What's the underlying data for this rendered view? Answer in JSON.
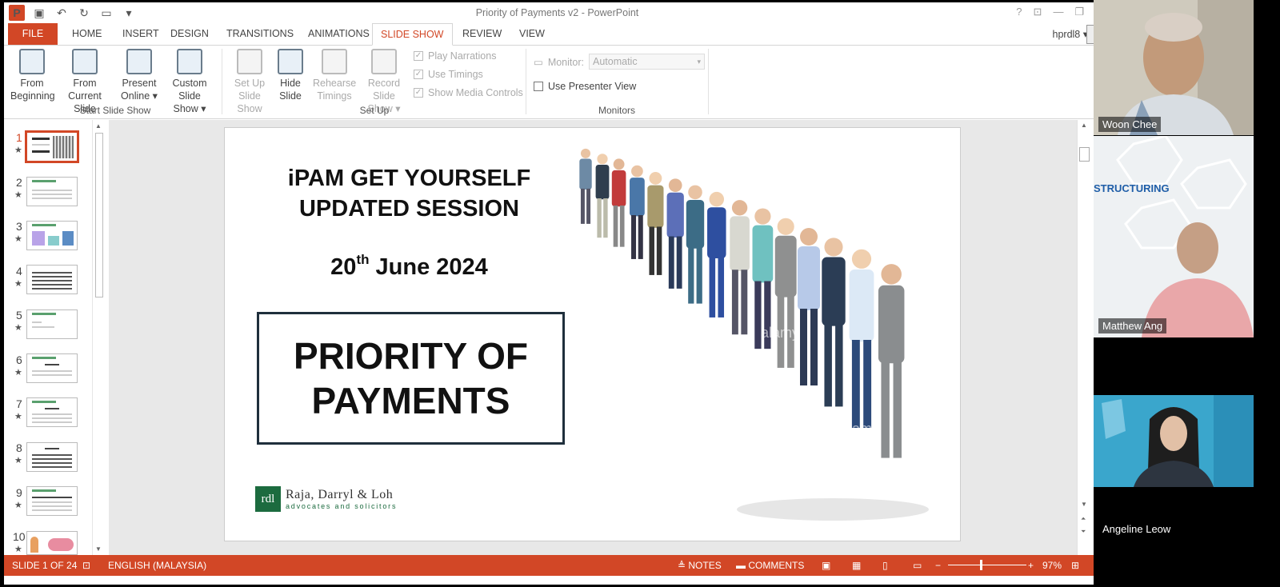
{
  "window": {
    "title": "Priority of Payments v2 - PowerPoint",
    "controls": [
      "?",
      "⊡",
      "—",
      "❐",
      "✕"
    ]
  },
  "qat": {
    "icons": [
      "powerpoint-icon",
      "save-icon",
      "undo-icon",
      "redo-icon",
      "present-icon",
      "customize-icon"
    ]
  },
  "tabs": [
    "FILE",
    "HOME",
    "INSERT",
    "DESIGN",
    "TRANSITIONS",
    "ANIMATIONS",
    "SLIDE SHOW",
    "REVIEW",
    "VIEW"
  ],
  "active_tab": "SLIDE SHOW",
  "user": {
    "name": "hprdl8"
  },
  "ribbon": {
    "start": {
      "from_beginning": [
        "From",
        "Beginning"
      ],
      "from_current": [
        "From",
        "Current Slide"
      ],
      "present_online": [
        "Present",
        "Online ▾"
      ],
      "custom_show": [
        "Custom Slide",
        "Show ▾"
      ],
      "label": "Start Slide Show"
    },
    "setup": {
      "setup_show": [
        "Set Up",
        "Slide Show"
      ],
      "hide_slide": [
        "Hide",
        "Slide"
      ],
      "rehearse": [
        "Rehearse",
        "Timings"
      ],
      "record": [
        "Record Slide",
        "Show ▾"
      ],
      "play_narrations": "Play Narrations",
      "use_timings": "Use Timings",
      "show_media": "Show Media Controls",
      "label": "Set Up"
    },
    "monitors": {
      "monitor_label": "Monitor:",
      "monitor_value": "Automatic",
      "presenter_view": "Use Presenter View",
      "label": "Monitors"
    }
  },
  "thumbnails": {
    "numbers": [
      "1",
      "2",
      "3",
      "4",
      "5",
      "6",
      "7",
      "8",
      "9",
      "10"
    ],
    "selected": "1"
  },
  "slide": {
    "title_line1": "iPAM GET YOURSELF",
    "title_line2": "UPDATED SESSION",
    "date_day": "20",
    "date_suffix": "th",
    "date_rest": " June 2024",
    "box_line1": "PRIORITY OF",
    "box_line2": "PAYMENTS",
    "logo_mark": "rdl",
    "logo_name": "Raja, Darryl & Loh",
    "logo_sub": "advocates and solicitors",
    "watermark": "alamy"
  },
  "status": {
    "slide_info": "SLIDE 1 OF 24",
    "language": "ENGLISH (MALAYSIA)",
    "notes": "NOTES",
    "comments": "COMMENTS",
    "zoom": "97%"
  },
  "participants": [
    {
      "name": "Woon Chee"
    },
    {
      "name": "Matthew Ang",
      "banner": "STRUCTURING"
    },
    {
      "name": "Angeline Leow"
    }
  ],
  "colors": {
    "accent": "#d24726",
    "slide_border": "#1f2f3c",
    "logo_green": "#1c6b3f"
  }
}
